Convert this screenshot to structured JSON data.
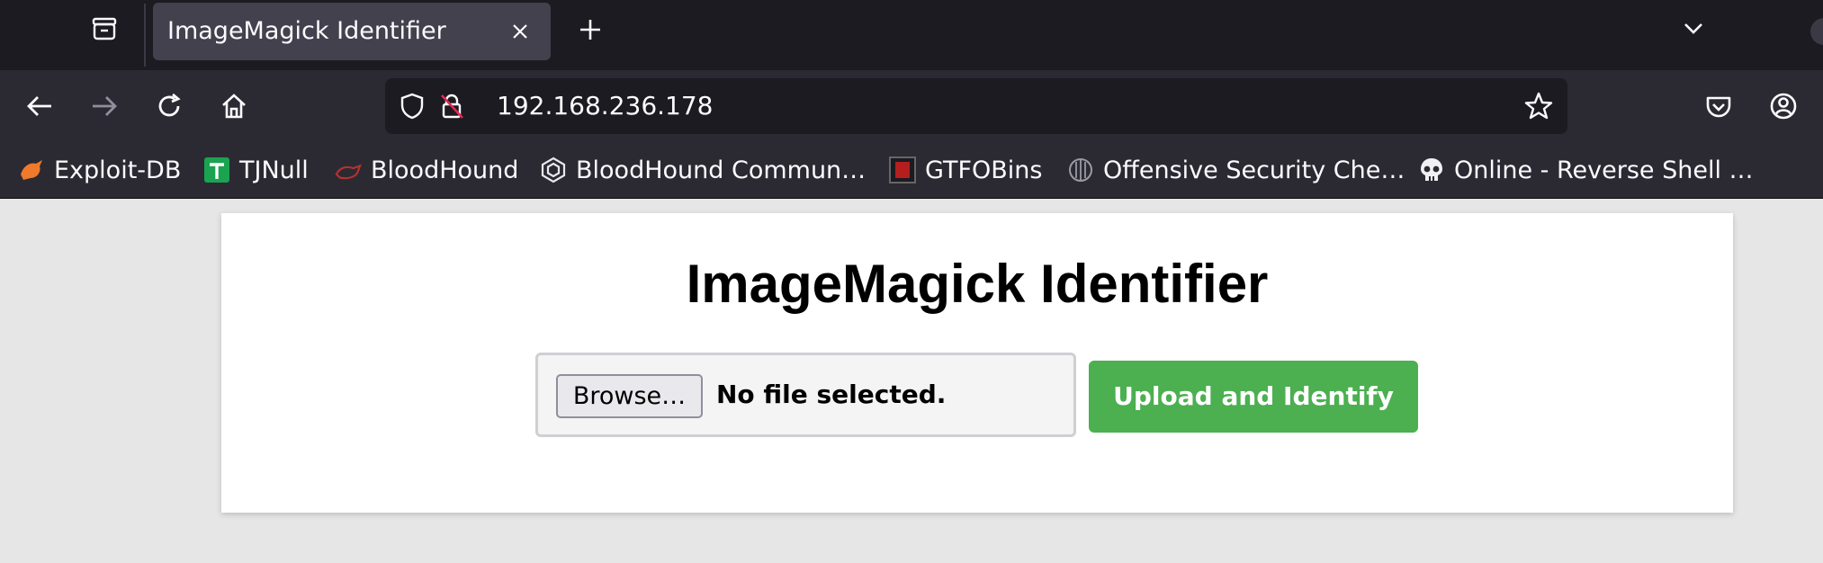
{
  "tab": {
    "title": "ImageMagick Identifier"
  },
  "address_bar": {
    "url": "192.168.236.178"
  },
  "bookmarks": [
    {
      "label": "Exploit-DB",
      "icon": "exploit-db-icon"
    },
    {
      "label": "TJNull",
      "icon": "tjnull-icon"
    },
    {
      "label": "BloodHound",
      "icon": "bloodhound-icon"
    },
    {
      "label": "BloodHound Commun…",
      "icon": "hexagon-icon"
    },
    {
      "label": "GTFOBins",
      "icon": "gtfobins-icon"
    },
    {
      "label": "Offensive Security Che…",
      "icon": "shell-icon"
    },
    {
      "label": "Online - Reverse Shell …",
      "icon": "skull-icon"
    }
  ],
  "page": {
    "heading": "ImageMagick Identifier",
    "browse_label": "Browse…",
    "file_status": "No file selected.",
    "submit_label": "Upload and Identify"
  },
  "colors": {
    "tab_strip": "#1c1b22",
    "toolbar": "#2b2a33",
    "submit_button": "#4caf50",
    "page_background": "#e6e6e6"
  }
}
